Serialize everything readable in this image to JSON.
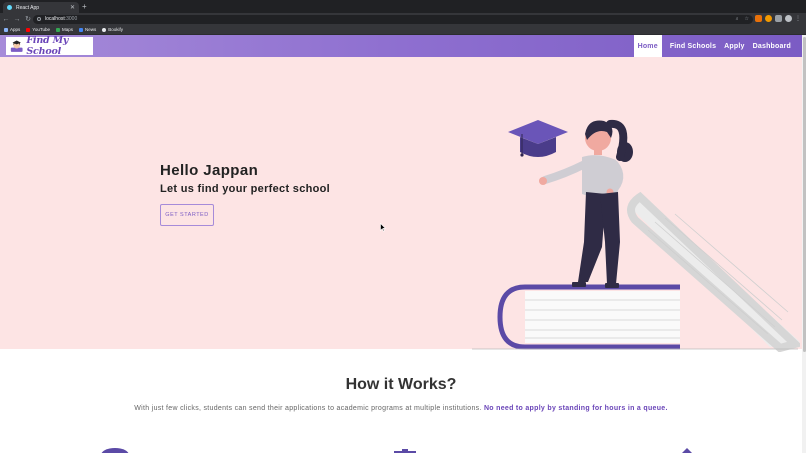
{
  "browser": {
    "tab_title": "React App",
    "tab_close": "✕",
    "new_tab": "+",
    "url_host": "localhost",
    "url_port": ":3000",
    "bookmarks": [
      {
        "label": "Apps",
        "color": "#8ab4f8"
      },
      {
        "label": "YouTube",
        "color": "#ff0000"
      },
      {
        "label": "Maps",
        "color": "#34a853"
      },
      {
        "label": "News",
        "color": "#4285f4"
      },
      {
        "label": "Bookify",
        "color": "#e8eaed"
      }
    ]
  },
  "header": {
    "logo_text": "Find My School",
    "nav": [
      {
        "label": "Home",
        "active": true
      },
      {
        "label": "Find Schools",
        "active": false
      },
      {
        "label": "Apply",
        "active": false
      },
      {
        "label": "Dashboard",
        "active": false
      }
    ]
  },
  "hero": {
    "greeting": "Hello Jappan",
    "subtitle": "Let us find your perfect school",
    "cta_label": "GET STARTED"
  },
  "how": {
    "title": "How it Works?",
    "desc_plain": "With just few clicks, students can send their applications to academic programs at multiple institutions.",
    "desc_highlight": "No need to apply by standing for hours in a queue."
  },
  "colors": {
    "accent": "#7b5cc4",
    "hero_bg": "#fde4e4",
    "header_gradient_start": "#a68bd9"
  }
}
